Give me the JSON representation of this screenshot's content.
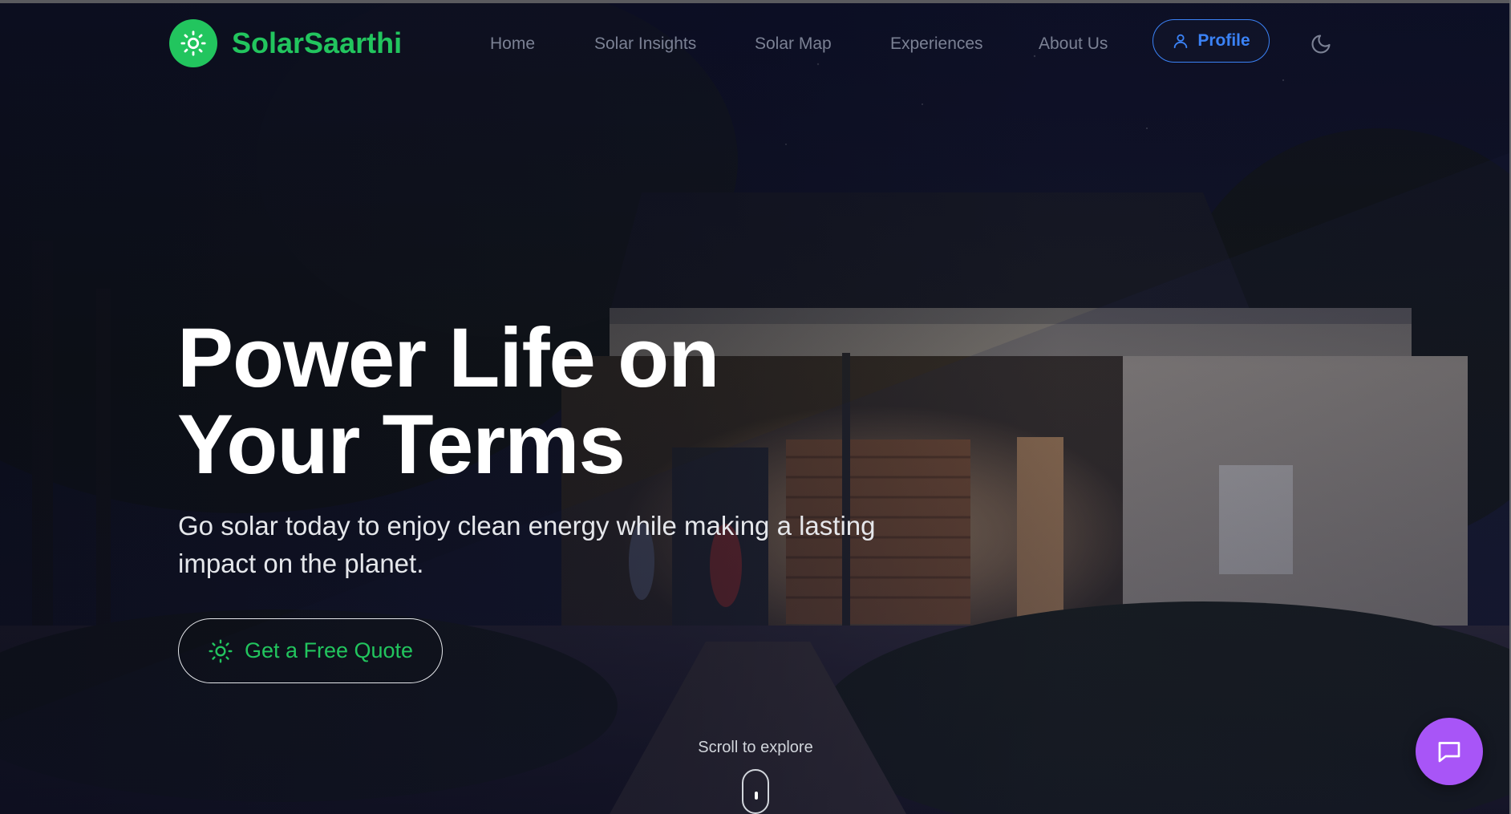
{
  "brand": {
    "name": "SolarSaarthi",
    "logo_icon": "sun-icon",
    "color": "#22c55e"
  },
  "nav": {
    "links": [
      {
        "label": "Home"
      },
      {
        "label": "Solar Insights"
      },
      {
        "label": "Solar Map"
      },
      {
        "label": "Experiences"
      },
      {
        "label": "About Us"
      }
    ],
    "profile_label": "Profile",
    "profile_icon": "user-icon",
    "profile_color": "#3b82f6",
    "theme_icon": "moon-icon"
  },
  "hero": {
    "title_line1": "Power Life on",
    "title_line2": "Your Terms",
    "subtitle_line1": "Go solar today to enjoy clean energy while making a lasting",
    "subtitle_line2": "impact on the planet.",
    "cta_label": "Get a Free Quote",
    "cta_icon": "sun-icon",
    "scroll_label": "Scroll to explore",
    "scroll_icon": "mouse-icon"
  },
  "chat": {
    "icon": "chat-bubble-icon",
    "color": "#a855f7"
  }
}
